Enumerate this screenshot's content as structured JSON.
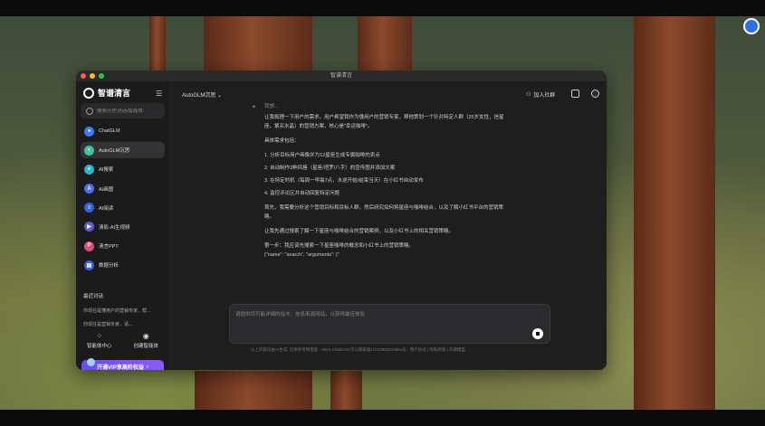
{
  "window": {
    "title": "智谱清言"
  },
  "sidebar": {
    "brand": "智谱清言",
    "search_placeholder": "搜索历史对话/智能体",
    "items": [
      {
        "label": "ChatGLM",
        "icon": "chatglm-icon",
        "color": "#3b7cff"
      },
      {
        "label": "AutoGLM沉思",
        "icon": "autoglm-icon",
        "color": "#3ec4a0"
      },
      {
        "label": "AI搜索",
        "icon": "ai-search-icon",
        "color": "#2bb3c8"
      },
      {
        "label": "AI画图",
        "icon": "ai-draw-icon",
        "color": "#4a6cf7"
      },
      {
        "label": "AI阅读",
        "icon": "ai-read-icon",
        "color": "#3a62d9"
      },
      {
        "label": "清影-AI生视频",
        "icon": "ai-video-icon",
        "color": "#5b5bd6"
      },
      {
        "label": "清言PPT",
        "icon": "ppt-icon",
        "color": "#d64f7a"
      },
      {
        "label": "数据分析",
        "icon": "data-analysis-icon",
        "color": "#3a62d9"
      }
    ],
    "recent_title": "最近对话",
    "recent": [
      "你现在是懂用户的营销专家，帮...",
      "你现在是营销专家，请..."
    ],
    "tools": [
      {
        "label": "智能体中心",
        "icon": "grid-icon"
      },
      {
        "label": "创建智能体",
        "icon": "create-agent-icon"
      }
    ],
    "vip_label": "开通VIP享高阶权益"
  },
  "header": {
    "model": "AutoGLM沉思",
    "join_label": "加入社群"
  },
  "chat": {
    "lines": [
      "我想...",
      "让我梳理一下用户的需求。用户希望我作为懂用户的营销专家，帮他策划一个针对特定人群（25岁女性，信星",
      "座，紫买水晶）的营销方案，核心是\"幸运咖啡\"。",
      "具体需求包括：",
      "1. 分析目标用户画像并为12星座生成专属咖啡的卖点",
      "2. 自动制作3种风格（星座/塔罗/八字）的宣传图并添加文案",
      "3. 在特定时机（每周一早晨7点，水逆开始/结束当天）在小红书自动发布",
      "4. 监控评论区并自动回复特定问题",
      "首先，我需要分析这个营销目标和目标人群，然后研究如何将星座与咖啡结合，以及了解小红书平台的营销策",
      "略。",
      "让我先通过搜索了解一下星座与咖啡结合的营销案例，以及小红书上的相关营销策略。",
      "第一步：我应该先搜索一下星座咖啡的概念和小红书上的营销策略。",
      "{\"name\": \"search\", \"arguments\": {\""
    ]
  },
  "composer": {
    "placeholder": "请提供尽可能详细的指令、信息来源网站，以获得最佳体验"
  },
  "footer": "以上内容均由AI生成, 仅供参考和借鉴 · 2024 ChatGLM 京公网安备11010802043564号 · 用户协议 | 隐私政策 | 开源模型"
}
